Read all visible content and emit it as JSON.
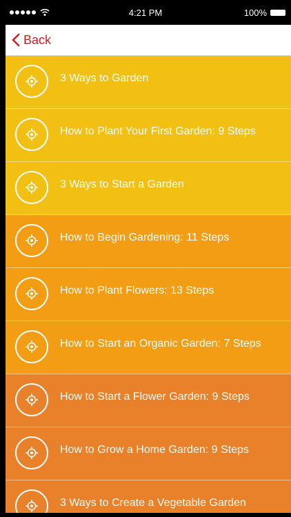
{
  "status_bar": {
    "time": "4:21 PM",
    "battery": "100%",
    "signal_icon": "signal-dots-icon",
    "wifi_icon": "wifi-icon",
    "battery_icon": "battery-icon"
  },
  "nav": {
    "back_label": "Back",
    "back_icon": "chevron-left-icon",
    "accent_color": "#cf1f22"
  },
  "colors": {
    "yellow": "#f2c013",
    "orange": "#f29d13",
    "dark_orange": "#e8812a"
  },
  "items": [
    {
      "label": "3 Ways to Garden",
      "color": "#f2c013",
      "icon": "target-icon"
    },
    {
      "label": "How to Plant Your First Garden: 9 Steps",
      "color": "#f2c013",
      "icon": "target-icon"
    },
    {
      "label": "3 Ways to Start a Garden",
      "color": "#f2c013",
      "icon": "target-icon"
    },
    {
      "label": "How to Begin Gardening: 11 Steps",
      "color": "#f29d13",
      "icon": "target-icon"
    },
    {
      "label": "How to Plant Flowers: 13 Steps",
      "color": "#f29d13",
      "icon": "target-icon"
    },
    {
      "label": "How to Start an Organic Garden: 7 Steps",
      "color": "#f29d13",
      "icon": "target-icon"
    },
    {
      "label": "How to Start a Flower Garden: 9 Steps",
      "color": "#e8812a",
      "icon": "target-icon"
    },
    {
      "label": "How to Grow a Home Garden: 9 Steps",
      "color": "#e8812a",
      "icon": "target-icon"
    },
    {
      "label": "3 Ways to Create a Vegetable Garden",
      "color": "#e8812a",
      "icon": "target-icon"
    }
  ]
}
